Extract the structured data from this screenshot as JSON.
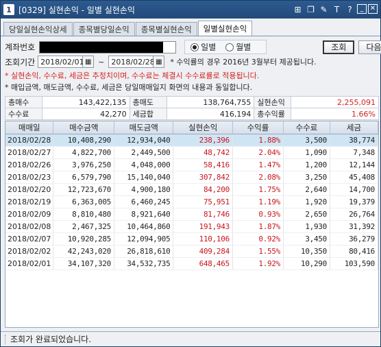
{
  "window": {
    "number": "1",
    "title": "[0329] 실현손익 - 일별 실현손익",
    "buttons": [
      "⊞",
      "❐",
      "✎",
      "T",
      "?",
      "_",
      "✕"
    ]
  },
  "tabs": [
    {
      "label": "당일실현손익상세",
      "active": false
    },
    {
      "label": "종목별당일손익",
      "active": false
    },
    {
      "label": "종목별실현손익",
      "active": false
    },
    {
      "label": "일별실현손익",
      "active": true
    }
  ],
  "form": {
    "account_label": "계좌번호",
    "radio_daily": "일별",
    "radio_monthly": "월별",
    "query_button": "조회",
    "next_button": "다음",
    "period_label": "조회기간",
    "date_from": "2018/02/01",
    "date_to": "2018/02/28",
    "tilde": "~",
    "rate_note": "* 수익률의 경우 2016년 3월부터 제공됩니다.",
    "warning": "* 실현손익, 수수료, 세금은 추정치이며, 수수료는 체결시 수수료률로 적용됩니다.",
    "info": "* 매입금액, 매도금액, 수수료, 세금은 당일매매일지 화면의 내용과 동일합니다."
  },
  "summary": {
    "buy_total_label": "총매수",
    "buy_total": "143,422,135",
    "sell_total_label": "총매도",
    "sell_total": "138,764,755",
    "realized_label": "실현손익",
    "realized": "2,255,091",
    "fee_label": "수수료",
    "fee": "42,270",
    "tax_label": "세금합",
    "tax": "416,194",
    "rate_label": "총수익률",
    "rate": "1.66%"
  },
  "grid": {
    "headers": [
      "매매일",
      "매수금액",
      "매도금액",
      "실현손익",
      "수익률",
      "수수료",
      "세금"
    ],
    "rows": [
      [
        "2018/02/28",
        "10,408,290",
        "12,934,040",
        "238,396",
        "1.88%",
        "3,500",
        "38,774"
      ],
      [
        "2018/02/27",
        "4,822,700",
        "2,449,500",
        "48,742",
        "2.04%",
        "1,090",
        "7,348"
      ],
      [
        "2018/02/26",
        "3,976,250",
        "4,048,000",
        "58,416",
        "1.47%",
        "1,200",
        "12,144"
      ],
      [
        "2018/02/23",
        "6,579,790",
        "15,140,040",
        "307,842",
        "2.08%",
        "3,250",
        "45,408"
      ],
      [
        "2018/02/20",
        "12,723,670",
        "4,900,180",
        "84,200",
        "1.75%",
        "2,640",
        "14,700"
      ],
      [
        "2018/02/19",
        "6,363,005",
        "6,460,245",
        "75,951",
        "1.19%",
        "1,920",
        "19,379"
      ],
      [
        "2018/02/09",
        "8,810,480",
        "8,921,640",
        "81,746",
        "0.93%",
        "2,650",
        "26,764"
      ],
      [
        "2018/02/08",
        "2,467,325",
        "10,464,860",
        "191,943",
        "1.87%",
        "1,930",
        "31,392"
      ],
      [
        "2018/02/07",
        "10,920,285",
        "12,094,905",
        "110,106",
        "0.92%",
        "3,450",
        "36,279"
      ],
      [
        "2018/02/02",
        "42,243,020",
        "26,818,610",
        "409,284",
        "1.55%",
        "10,350",
        "80,416"
      ],
      [
        "2018/02/01",
        "34,107,320",
        "34,532,735",
        "648,465",
        "1.92%",
        "10,290",
        "103,590"
      ]
    ]
  },
  "status": {
    "message": "조회가 완료되었습니다."
  },
  "colors": {
    "positive": "#c8161d",
    "selected_row": "#cfe5f4",
    "title_bar": "#2c5a90"
  }
}
